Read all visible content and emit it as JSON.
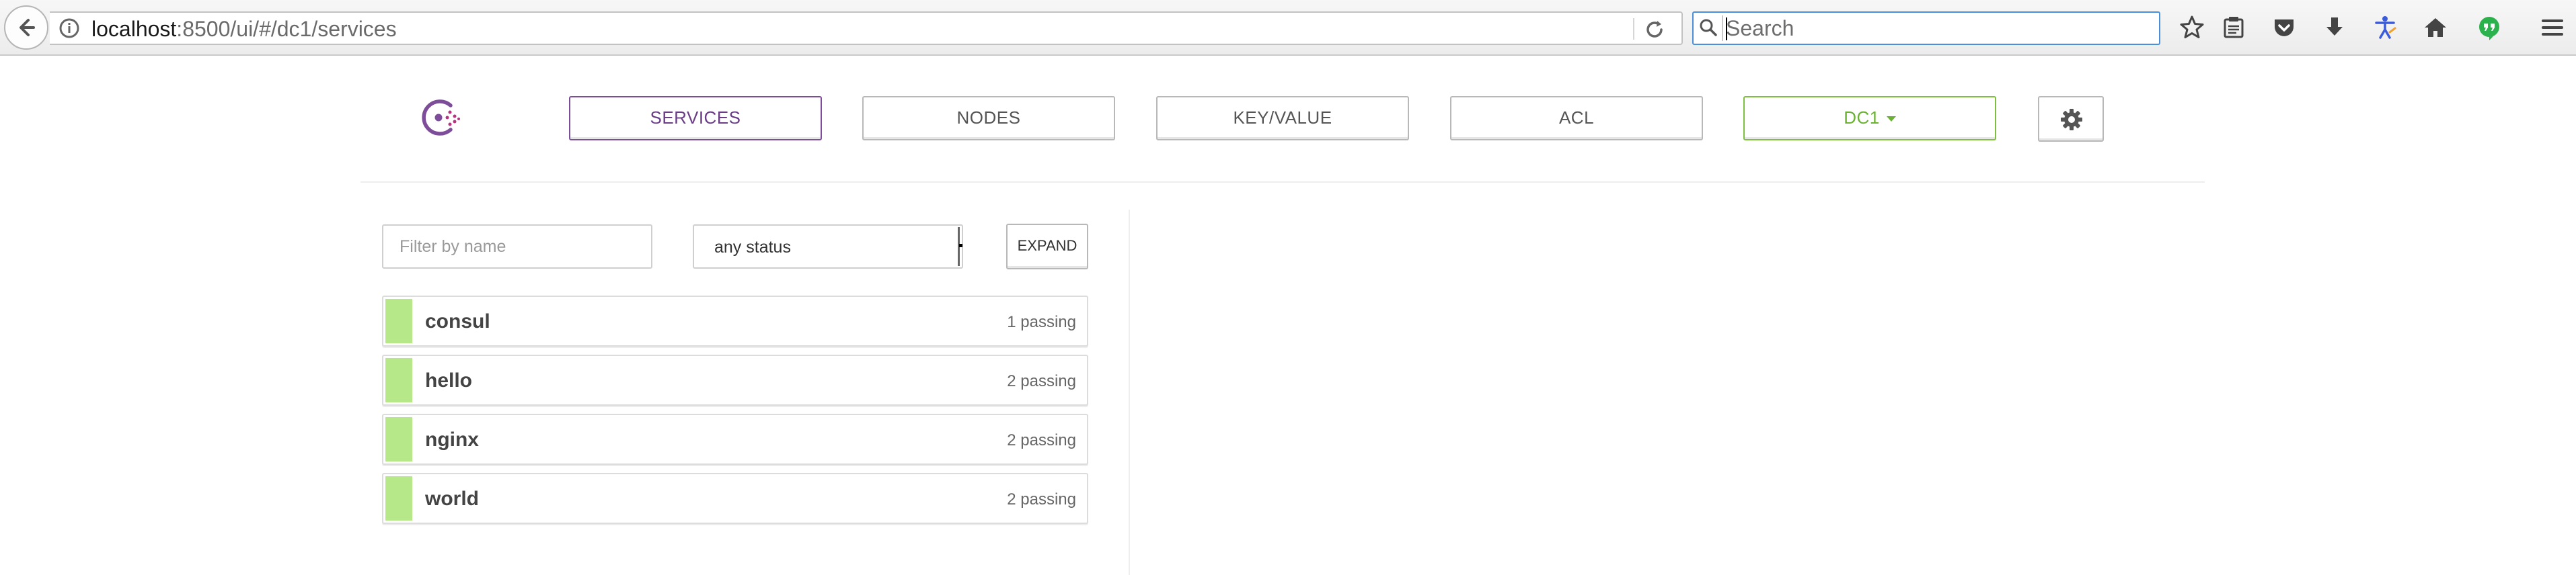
{
  "browser": {
    "url_host": "localhost",
    "url_rest": ":8500/ui/#/dc1/services",
    "search_placeholder": "Search",
    "icons": [
      "back-arrow-icon",
      "info-icon",
      "reload-icon",
      "search-icon",
      "bookmark-star-icon",
      "reading-list-icon",
      "pocket-icon",
      "download-icon",
      "accessibility-icon",
      "home-icon",
      "hangouts-icon",
      "menu-icon"
    ]
  },
  "header": {
    "nav": [
      {
        "label": "SERVICES",
        "active": true
      },
      {
        "label": "NODES"
      },
      {
        "label": "KEY/VALUE"
      },
      {
        "label": "ACL"
      }
    ],
    "datacenter_label": "DC1",
    "colors": {
      "brand": "#7e4d99",
      "datacenter": "#6ab232",
      "passing": "#b6e88a"
    }
  },
  "filters": {
    "name_placeholder": "Filter by name",
    "status_value": "any status",
    "expand_label": "EXPAND"
  },
  "services": [
    {
      "name": "consul",
      "status": "1 passing"
    },
    {
      "name": "hello",
      "status": "2 passing"
    },
    {
      "name": "nginx",
      "status": "2 passing"
    },
    {
      "name": "world",
      "status": "2 passing"
    }
  ]
}
